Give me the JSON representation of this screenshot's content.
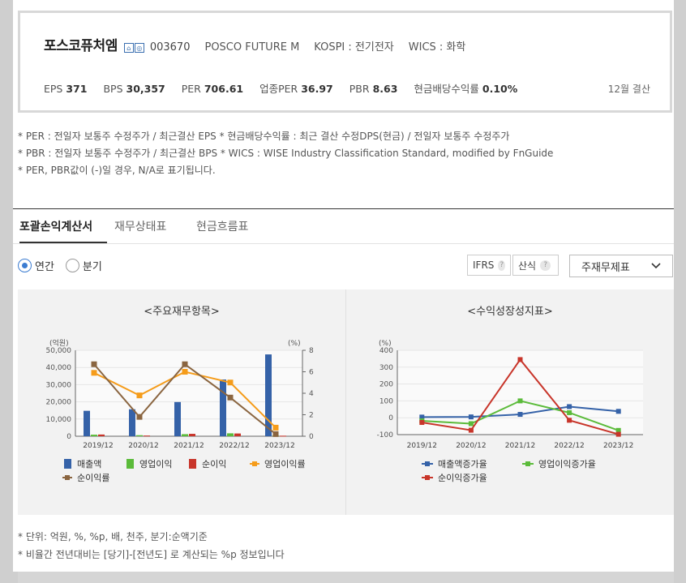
{
  "header": {
    "company": "포스코퓨처엠",
    "badges": [
      "⌂",
      "◎"
    ],
    "code": "003670",
    "english_name": "POSCO FUTURE M",
    "market": "KOSPI : 전기전자",
    "wics": "WICS : 화학",
    "metrics": [
      {
        "label": "EPS",
        "value": "371"
      },
      {
        "label": "BPS",
        "value": "30,357"
      },
      {
        "label": "PER",
        "value": "706.61"
      },
      {
        "label": "업종PER",
        "value": "36.97"
      },
      {
        "label": "PBR",
        "value": "8.63"
      },
      {
        "label": "현금배당수익률",
        "value": "0.10%"
      }
    ],
    "fiscal": "12월 결산"
  },
  "notes": [
    "* PER : 전일자 보통주 수정주가 / 최근결산 EPS * 현금배당수익률 : 최근 결산 수정DPS(현금) / 전일자 보통주 수정주가",
    "* PBR : 전일자 보통주 수정주가 / 최근결산 BPS * WICS : WISE Industry Classification Standard, modified by FnGuide",
    "* PER, PBR값이 (-)일 경우, N/A로 표기됩니다."
  ],
  "tabs": [
    "포괄손익계산서",
    "재무상태표",
    "현금흐름표"
  ],
  "period": {
    "annual": "연간",
    "quarter": "분기"
  },
  "options": {
    "ifrs": "IFRS",
    "calc": "산식",
    "help": "?",
    "select": "주재무제표"
  },
  "colors": {
    "revenue": "#3562a8",
    "op_profit": "#5bbb3a",
    "net_profit": "#c8352a",
    "op_margin": "#f59c1a",
    "net_margin": "#8a6540"
  },
  "chart_data": [
    {
      "type": "bar",
      "title": "<주요재무항목>",
      "categories": [
        "2019/12",
        "2020/12",
        "2021/12",
        "2022/12",
        "2023/12"
      ],
      "y_left_unit": "(억원)",
      "y_right_unit": "(%)",
      "y_left_ticks": [
        "0",
        "10,000",
        "20,000",
        "30,000",
        "40,000",
        "50,000"
      ],
      "y_right_ticks": [
        "0",
        "2",
        "4",
        "6",
        "8"
      ],
      "ylim": [
        0,
        50000
      ],
      "y2lim": [
        0,
        8
      ],
      "series": [
        {
          "name": "매출액",
          "kind": "bar",
          "axis": "left",
          "values": [
            14800,
            15700,
            19900,
            33000,
            47600
          ]
        },
        {
          "name": "영업이익",
          "kind": "bar",
          "axis": "left",
          "values": [
            900,
            600,
            1200,
            1700,
            400
          ]
        },
        {
          "name": "순이익",
          "kind": "bar",
          "axis": "left",
          "values": [
            1000,
            400,
            1400,
            1600,
            300
          ]
        },
        {
          "name": "영업이익률",
          "kind": "line",
          "axis": "right",
          "values": [
            5.9,
            3.8,
            6.0,
            5.0,
            0.8
          ]
        },
        {
          "name": "순이익률",
          "kind": "line",
          "axis": "right",
          "values": [
            6.7,
            1.8,
            6.7,
            3.6,
            0.2
          ]
        }
      ]
    },
    {
      "type": "line",
      "title": "<수익성장성지표>",
      "categories": [
        "2019/12",
        "2020/12",
        "2021/12",
        "2022/12",
        "2023/12"
      ],
      "y_unit": "(%)",
      "y_ticks": [
        "-100",
        "0",
        "100",
        "200",
        "300",
        "400"
      ],
      "ylim": [
        -100,
        400
      ],
      "series": [
        {
          "name": "매출액증가율",
          "values": [
            4,
            5,
            20,
            66,
            38
          ]
        },
        {
          "name": "영업이익증가율",
          "values": [
            -18,
            -35,
            100,
            30,
            -75
          ]
        },
        {
          "name": "순이익증가율",
          "values": [
            -28,
            -74,
            345,
            -15,
            -98
          ]
        }
      ]
    }
  ],
  "footnotes": [
    "* 단위: 억원, %, %p, 배, 천주, 분기:순액기준",
    "* 비율간 전년대비는 [당기]-[전년도] 로 계산되는 %p 정보입니다"
  ]
}
